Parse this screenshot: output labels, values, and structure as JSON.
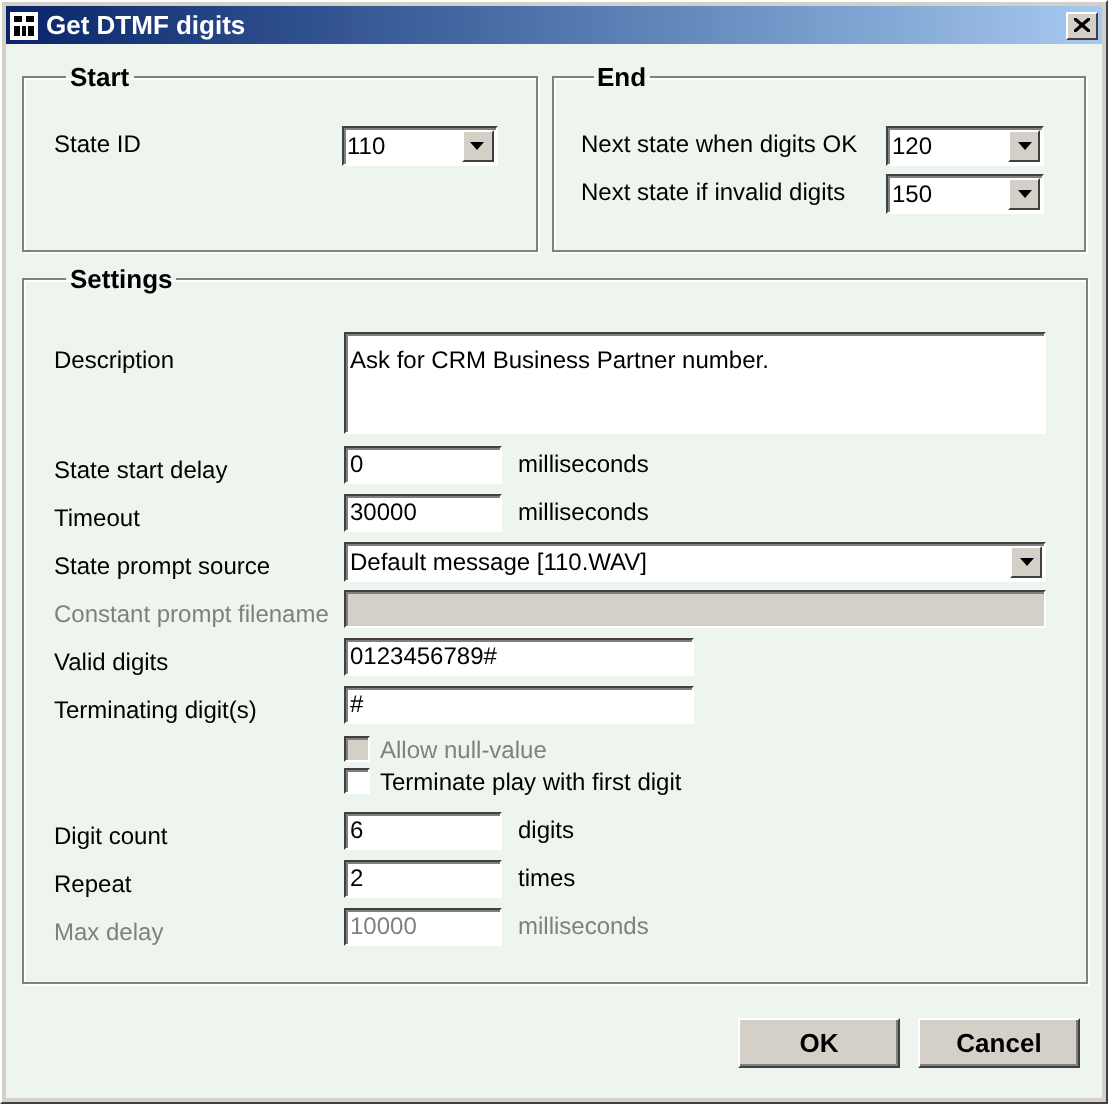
{
  "window": {
    "title": "Get DTMF digits"
  },
  "start": {
    "title": "Start",
    "fields": [
      {
        "label": "State ID",
        "value": "110"
      }
    ]
  },
  "end": {
    "title": "End",
    "fields": [
      {
        "label": "Next state when digits OK",
        "value": "120"
      },
      {
        "label": "Next state if invalid digits",
        "value": "150"
      }
    ]
  },
  "settings": {
    "title": "Settings",
    "rows": [
      {
        "kind": "memo",
        "label": "Description",
        "value": "Ask for CRM Business Partner number.",
        "disabled": false
      },
      {
        "kind": "number",
        "label": "State start delay",
        "value": "0",
        "unit": "milliseconds",
        "disabled": false
      },
      {
        "kind": "number",
        "label": "Timeout",
        "value": "30000",
        "unit": "milliseconds",
        "disabled": false
      },
      {
        "kind": "dropdown",
        "label": "State prompt source",
        "value": "Default message [110.WAV]",
        "disabled": false
      },
      {
        "kind": "path",
        "label": "Constant prompt filename",
        "disabled": true
      },
      {
        "kind": "text",
        "label": "Valid digits",
        "value": "0123456789#",
        "disabled": false
      },
      {
        "kind": "text",
        "label": "Terminating digit(s)",
        "value": "#",
        "disabled": false
      },
      {
        "kind": "checkbox",
        "label": "Allow null-value",
        "checked": false,
        "disabled": true
      },
      {
        "kind": "checkbox",
        "label": "Terminate play with first digit",
        "checked": false,
        "disabled": false
      },
      {
        "kind": "number",
        "label": "Digit count",
        "value": "6",
        "unit": "digits",
        "disabled": false
      },
      {
        "kind": "number",
        "label": "Repeat",
        "value": "2",
        "unit": "times",
        "disabled": false
      },
      {
        "kind": "number",
        "label": "Max delay",
        "value": "10000",
        "unit": "milliseconds",
        "disabled": true
      }
    ]
  },
  "buttons": [
    {
      "label": "OK"
    },
    {
      "label": "Cancel"
    }
  ]
}
